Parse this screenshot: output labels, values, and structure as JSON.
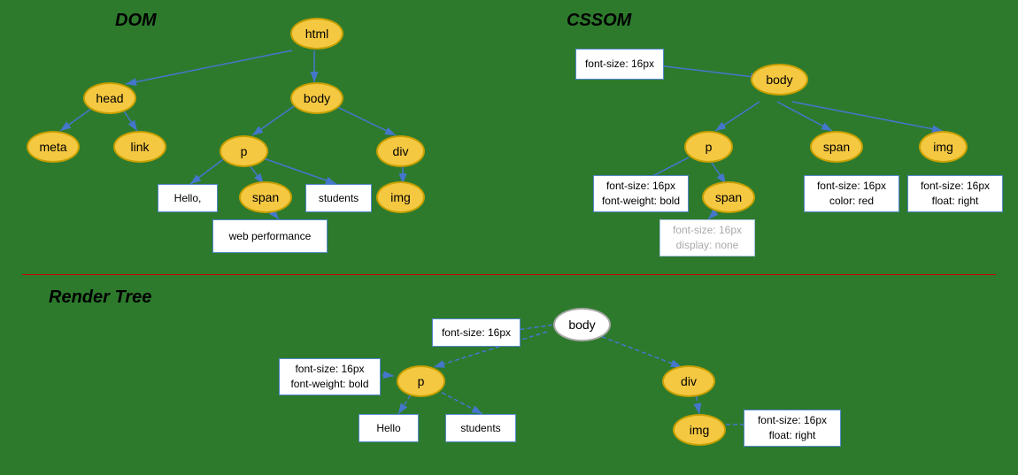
{
  "dom_title": "DOM",
  "cssom_title": "CSSOM",
  "render_title": "Render Tree",
  "dom": {
    "html": "html",
    "head": "head",
    "body": "body",
    "meta": "meta",
    "link": "link",
    "p": "p",
    "div": "div",
    "span": "span",
    "img": "img",
    "hello": "Hello,",
    "students": "students",
    "web_performance": "web performance"
  },
  "cssom": {
    "body": "body",
    "p": "p",
    "span_p": "span",
    "span_top": "span",
    "img": "img",
    "box_body": "font-size: 16px",
    "box_p": "font-size: 16px\nfont-weight: bold",
    "box_span_p": "font-size: 16px\ndisplay: none",
    "box_span": "font-size: 16px\ncolor: red",
    "box_img": "font-size: 16px\nfloat: right"
  },
  "render": {
    "body": "body",
    "p": "p",
    "div": "div",
    "img": "img",
    "hello": "Hello",
    "students": "students",
    "box_body": "font-size: 16px",
    "box_p": "font-size: 16px\nfont-weight: bold",
    "box_img": "font-size: 16px\nfloat: right"
  }
}
